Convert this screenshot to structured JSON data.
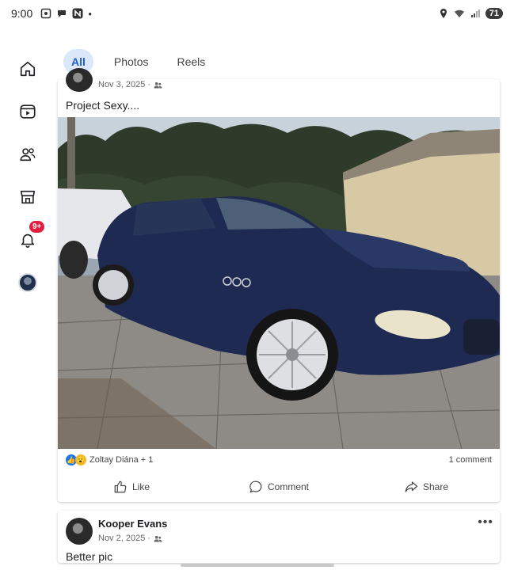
{
  "status_bar": {
    "time": "9:00",
    "battery": "71"
  },
  "colors": {
    "accent": "#1f5bd1",
    "active_tab_bg": "#dbe7fb",
    "badge": "#e41e3f",
    "like_blue": "#1877f2"
  },
  "rail": {
    "items": [
      {
        "name": "home",
        "icon": "home-icon"
      },
      {
        "name": "video",
        "icon": "video-icon"
      },
      {
        "name": "friends",
        "icon": "friends-icon"
      },
      {
        "name": "marketplace",
        "icon": "marketplace-icon"
      },
      {
        "name": "notifications",
        "icon": "bell-icon",
        "badge": "9+"
      },
      {
        "name": "profile",
        "icon": "avatar"
      }
    ]
  },
  "tabs": [
    {
      "label": "All",
      "active": true
    },
    {
      "label": "Photos",
      "active": false
    },
    {
      "label": "Reels",
      "active": false
    }
  ],
  "post1": {
    "date": "Nov 3, 2025 ·",
    "text": "Project Sexy....",
    "reactions": "Zoltay Diána + 1",
    "comments": "1 comment",
    "actions": {
      "like": "Like",
      "comment": "Comment",
      "share": "Share"
    }
  },
  "post2": {
    "author": "Kooper Evans",
    "date": "Nov 2, 2025 ·",
    "text": "Better pic",
    "more": "•••"
  }
}
